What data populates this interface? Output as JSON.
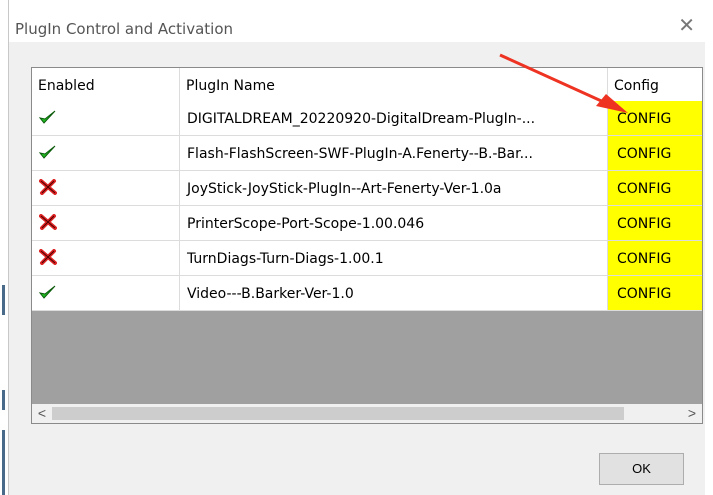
{
  "window": {
    "title": "PlugIn Control and Activation",
    "close_symbol": "✕"
  },
  "columns": {
    "enabled": "Enabled",
    "name": "PlugIn Name",
    "config": "Config"
  },
  "plugins": [
    {
      "enabled": true,
      "name": "DIGITALDREAM_20220920-DigitalDream-PlugIn-...",
      "config": "CONFIG"
    },
    {
      "enabled": true,
      "name": "Flash-FlashScreen-SWF-PlugIn-A.Fenerty--B.-Bar...",
      "config": "CONFIG"
    },
    {
      "enabled": false,
      "name": "JoyStick-JoyStick-PlugIn--Art-Fenerty-Ver-1.0a",
      "config": "CONFIG"
    },
    {
      "enabled": false,
      "name": "PrinterScope-Port-Scope-1.00.046",
      "config": "CONFIG"
    },
    {
      "enabled": false,
      "name": "TurnDiags-Turn-Diags-1.00.1",
      "config": "CONFIG"
    },
    {
      "enabled": true,
      "name": "Video---B.Barker-Ver-1.0",
      "config": "CONFIG"
    }
  ],
  "scrollbar": {
    "left": "<",
    "right": ">"
  },
  "buttons": {
    "ok": "OK"
  },
  "colors": {
    "config_bg": "#ffff00",
    "check": "#22bb22",
    "cross": "#dd2222",
    "annotation_arrow": "#ee3322"
  }
}
